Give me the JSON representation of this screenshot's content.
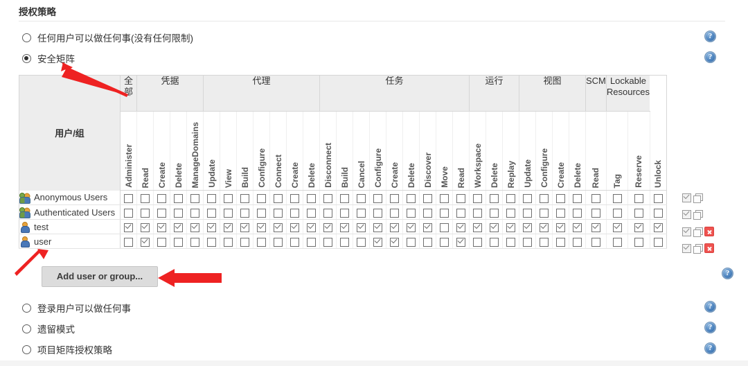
{
  "section": {
    "title": "授权策略"
  },
  "strategies": [
    {
      "label": "任何用户可以做任何事(没有任何限制)",
      "selected": false
    },
    {
      "label": "安全矩阵",
      "selected": true
    },
    {
      "label": "登录用户可以做任何事",
      "selected": false
    },
    {
      "label": "遗留模式",
      "selected": false
    },
    {
      "label": "项目矩阵授权策略",
      "selected": false
    }
  ],
  "matrix": {
    "user_group_header": "用户/组",
    "groups": [
      {
        "label": "全部",
        "span": 1
      },
      {
        "label": "凭据",
        "span": 4
      },
      {
        "label": "代理",
        "span": 7
      },
      {
        "label": "任务",
        "span": 9
      },
      {
        "label": "运行",
        "span": 3
      },
      {
        "label": "视图",
        "span": 4
      },
      {
        "label": "SCM",
        "span": 1
      },
      {
        "label": "Lockable Resources",
        "span": 2
      }
    ],
    "permissions": [
      "Administer",
      "Read",
      "Create",
      "Delete",
      "ManageDomains",
      "Update",
      "View",
      "Build",
      "Configure",
      "Connect",
      "Create",
      "Delete",
      "Disconnect",
      "Build",
      "Cancel",
      "Configure",
      "Create",
      "Delete",
      "Discover",
      "Move",
      "Read",
      "Workspace",
      "Delete",
      "Replay",
      "Update",
      "Configure",
      "Create",
      "Delete",
      "Read",
      "Tag",
      "Reserve",
      "Unlock"
    ],
    "rows": [
      {
        "name": "Anonymous Users",
        "icon": "group-icon",
        "deletable": false,
        "checks": [
          0,
          0,
          0,
          0,
          0,
          0,
          0,
          0,
          0,
          0,
          0,
          0,
          0,
          0,
          0,
          0,
          0,
          0,
          0,
          0,
          0,
          0,
          0,
          0,
          0,
          0,
          0,
          0,
          0,
          0,
          0,
          0
        ]
      },
      {
        "name": "Authenticated Users",
        "icon": "group-icon",
        "deletable": false,
        "checks": [
          0,
          0,
          0,
          0,
          0,
          0,
          0,
          0,
          0,
          0,
          0,
          0,
          0,
          0,
          0,
          0,
          0,
          0,
          0,
          0,
          0,
          0,
          0,
          0,
          0,
          0,
          0,
          0,
          0,
          0,
          0,
          0
        ]
      },
      {
        "name": "test",
        "icon": "user-icon",
        "deletable": true,
        "checks": [
          1,
          1,
          1,
          1,
          1,
          1,
          1,
          1,
          1,
          1,
          1,
          1,
          1,
          1,
          1,
          1,
          1,
          1,
          1,
          0,
          1,
          1,
          1,
          1,
          1,
          1,
          1,
          1,
          1,
          1,
          1,
          1
        ]
      },
      {
        "name": "user",
        "icon": "user-icon",
        "deletable": true,
        "checks": [
          0,
          1,
          0,
          0,
          0,
          0,
          0,
          0,
          0,
          0,
          0,
          0,
          0,
          0,
          0,
          1,
          1,
          0,
          0,
          0,
          1,
          0,
          0,
          0,
          0,
          0,
          0,
          0,
          0,
          0,
          0,
          0
        ]
      }
    ],
    "row_actions": {
      "select_all": "select-all-icon",
      "copy": "copy-icon",
      "delete": "delete-icon"
    }
  },
  "add_user_button": {
    "label": "Add user or group..."
  },
  "help": {
    "glyph": "?",
    "color": "#4a81bd"
  },
  "annotations": {
    "arrow_color": "#ee2222"
  }
}
